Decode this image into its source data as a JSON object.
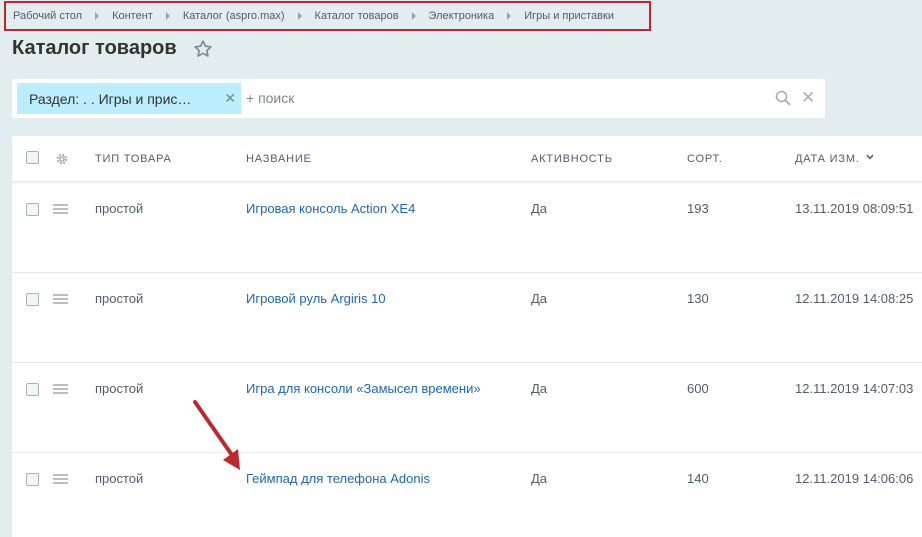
{
  "breadcrumb": [
    "Рабочий стол",
    "Контент",
    "Каталог (aspro.max)",
    "Каталог товаров",
    "Электроника",
    "Игры и приставки"
  ],
  "page_title": "Каталог товаров",
  "filter": {
    "chip_label": "Раздел: . . Игры и прис…",
    "placeholder": "+ поиск"
  },
  "columns": {
    "type": "ТИП ТОВАРА",
    "name": "НАЗВАНИЕ",
    "active": "АКТИВНОСТЬ",
    "sort": "СОРТ.",
    "date": "ДАТА ИЗМ."
  },
  "rows": [
    {
      "type": "простой",
      "name": "Игровая консоль Action XE4",
      "active": "Да",
      "sort": "193",
      "date": "13.11.2019 08:09:51"
    },
    {
      "type": "простой",
      "name": "Игровой руль Argiris 10",
      "active": "Да",
      "sort": "130",
      "date": "12.11.2019 14:08:25"
    },
    {
      "type": "простой",
      "name": "Игра для консоли «Замысел времени»",
      "active": "Да",
      "sort": "600",
      "date": "12.11.2019 14:07:03"
    },
    {
      "type": "простой",
      "name": "Геймпад для телефона Adonis",
      "active": "Да",
      "sort": "140",
      "date": "12.11.2019 14:06:06"
    }
  ],
  "colors": {
    "accent_link": "#2067b0",
    "annotation": "#c0272d",
    "chip_bg": "#bcedfc"
  }
}
